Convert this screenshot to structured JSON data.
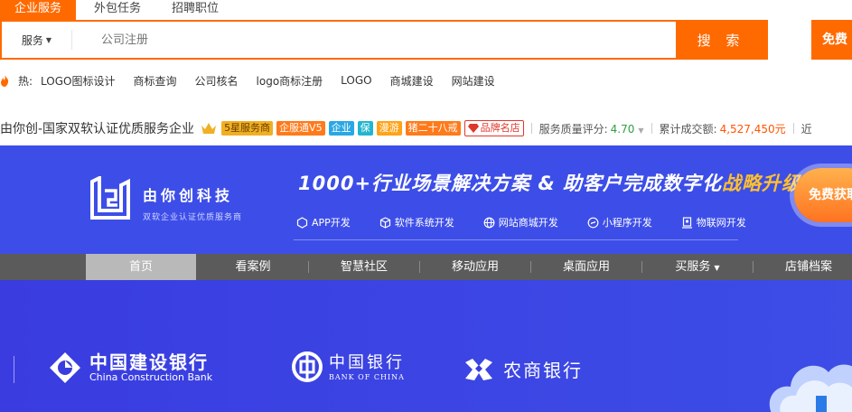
{
  "tabs": [
    "企业服务",
    "外包任务",
    "招聘职位"
  ],
  "search": {
    "category": "服务",
    "placeholder": "公司注册",
    "button": "搜 索",
    "free_button": "免费"
  },
  "hot": {
    "label": "热:",
    "items": [
      "LOGO图标设计",
      "商标查询",
      "公司核名",
      "logo商标注册",
      "LOGO",
      "商城建设",
      "网站建设"
    ]
  },
  "company": {
    "name": "由你创-国家双软认证优质服务企业",
    "badges": [
      "5星服务商",
      "企服通V5",
      "企业",
      "保",
      "漫游",
      "猪二十八戒"
    ],
    "brand": "品牌名店",
    "rating_label": "服务质量评分:",
    "rating_value": "4.70",
    "volume_label": "累计成交额:",
    "volume_value": "4,527,450元",
    "more": "近"
  },
  "banner": {
    "logo_name": "由你创科技",
    "logo_sub": "双软企业认证优质服务商",
    "headline_main": "1000+行业场景解决方案 & 助客户完成数字化",
    "headline_accent": "战略升级",
    "features": [
      "APP开发",
      "软件系统开发",
      "网站商城开发",
      "小程序开发",
      "物联网开发"
    ],
    "cta": "免费获取"
  },
  "nav": [
    "首页",
    "看案例",
    "智慧社区",
    "移动应用",
    "桌面应用",
    "买服务",
    "店铺档案"
  ],
  "banks": {
    "ccb_cn": "中国建设银行",
    "ccb_en": "China Construction Bank",
    "boc_cn": "中国银行",
    "boc_en": "BANK OF CHINA",
    "nsh_cn": "农商银行"
  },
  "colors": {
    "accent": "#ff6a00",
    "banner_bg": "#3d4ee8",
    "nav_bg": "#5b5b5b",
    "rating": "#2f9e44",
    "volume": "#ff5500"
  }
}
